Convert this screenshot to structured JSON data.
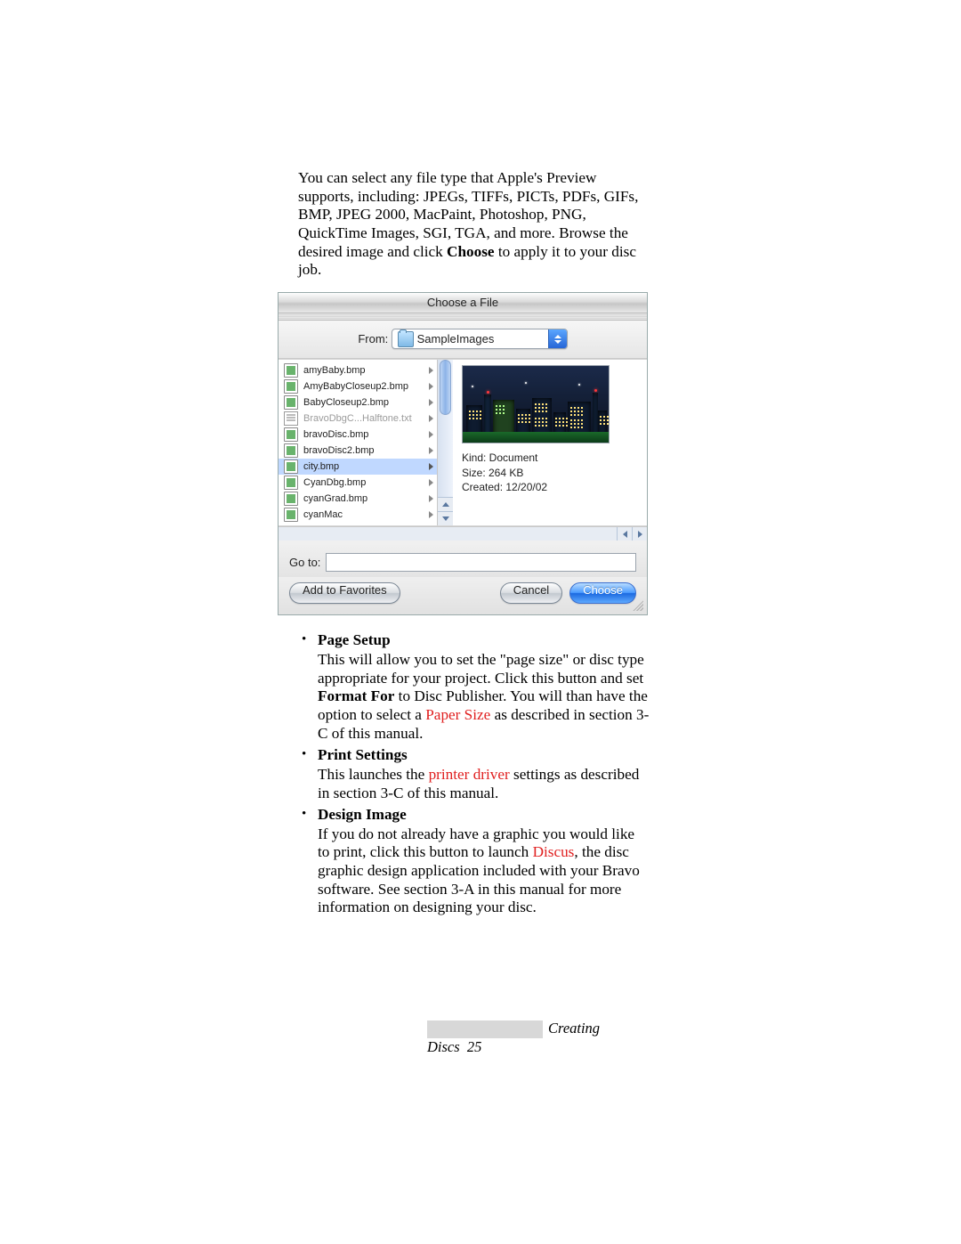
{
  "intro": {
    "pre": "You can select any file type that Apple's Preview supports, including: JPEGs, TIFFs, PICTs, PDFs, GIFs, BMP, JPEG 2000, MacPaint, Photoshop, PNG, QuickTime Images, SGI, TGA, and more.  Browse the desired image and click ",
    "bold": "Choose",
    "post": " to apply it to your disc job."
  },
  "dialog": {
    "title": "Choose a File",
    "from_label": "From:",
    "from_value": "SampleImages",
    "files": [
      {
        "name": "amyBaby.bmp",
        "icon": "bmp",
        "sel": false,
        "dim": false
      },
      {
        "name": "AmyBabyCloseup2.bmp",
        "icon": "bmp",
        "sel": false,
        "dim": false
      },
      {
        "name": "BabyCloseup2.bmp",
        "icon": "bmp",
        "sel": false,
        "dim": false
      },
      {
        "name": "BravoDbgC...Halftone.txt",
        "icon": "txt",
        "sel": false,
        "dim": true
      },
      {
        "name": "bravoDisc.bmp",
        "icon": "bmp",
        "sel": false,
        "dim": false
      },
      {
        "name": "bravoDisc2.bmp",
        "icon": "bmp",
        "sel": false,
        "dim": false
      },
      {
        "name": "city.bmp",
        "icon": "bmp",
        "sel": true,
        "dim": false
      },
      {
        "name": "CyanDbg.bmp",
        "icon": "bmp",
        "sel": false,
        "dim": false
      },
      {
        "name": "cyanGrad.bmp",
        "icon": "bmp",
        "sel": false,
        "dim": false
      },
      {
        "name": "cyanMac",
        "icon": "bmp",
        "sel": false,
        "dim": false
      }
    ],
    "meta": {
      "kind_label": "Kind: Document",
      "size_label": "Size: 264 KB",
      "created_label": "Created: 12/20/02"
    },
    "goto_label": "Go to:",
    "goto_value": "",
    "buttons": {
      "favorites": "Add to Favorites",
      "cancel": "Cancel",
      "choose": "Choose"
    }
  },
  "sections": [
    {
      "head": "Page Setup",
      "body_parts": [
        {
          "t": "This will allow you to set the \"page size\" or disc type appropriate for your project. Click this button and set "
        },
        {
          "t": "Format For",
          "bold": true
        },
        {
          "t": " to Disc Publisher. You will than have the option to select a "
        },
        {
          "t": "Paper Size",
          "red": true
        },
        {
          "t": " as described in section 3-C of this manual."
        }
      ]
    },
    {
      "head": "Print Settings",
      "body_parts": [
        {
          "t": "This launches the "
        },
        {
          "t": "printer driver",
          "red": true
        },
        {
          "t": " settings as described in section 3-C of this manual."
        }
      ]
    },
    {
      "head": "Design Image",
      "body_parts": [
        {
          "t": "If you do not already have a graphic you would like to print, click this button to launch "
        },
        {
          "t": "Discus",
          "red": true
        },
        {
          "t": ", the disc graphic design application included with your Bravo software. See section 3-A in this manual for more information on designing your disc."
        }
      ]
    }
  ],
  "footer": {
    "text": "Creating Discs",
    "page": "25"
  }
}
